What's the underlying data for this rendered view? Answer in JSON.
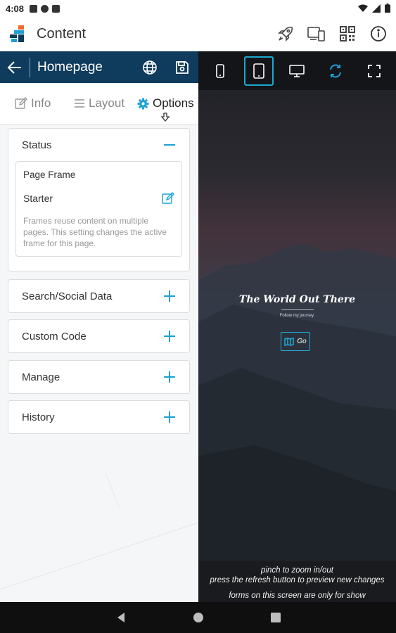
{
  "status_bar": {
    "time": "4:08"
  },
  "app": {
    "title": "Content"
  },
  "page": {
    "title": "Homepage"
  },
  "tabs": [
    {
      "label": "Info",
      "icon": "edit-icon"
    },
    {
      "label": "Layout",
      "icon": "lines-icon"
    },
    {
      "label": "Options",
      "icon": "gear-icon",
      "active": true
    }
  ],
  "options": {
    "status": {
      "title": "Status",
      "frame_label": "Page Frame",
      "frame_value": "Starter",
      "description": "Frames reuse content on multiple pages. This setting changes the active frame for this page."
    },
    "sections": [
      {
        "title": "Search/Social Data"
      },
      {
        "title": "Custom Code"
      },
      {
        "title": "Manage"
      },
      {
        "title": "History"
      }
    ]
  },
  "preview": {
    "hero_title": "The World Out There",
    "hero_subtitle": "Follow my journey.",
    "hero_button": "Go"
  },
  "notes": {
    "line1": "pinch to zoom in/out",
    "line2": "press the refresh button to preview new changes",
    "line3": "forms on this screen are only for show"
  },
  "colors": {
    "header": "#0f3b5c",
    "accent": "#1ba0d8",
    "preview_bg": "#1c1e22"
  }
}
